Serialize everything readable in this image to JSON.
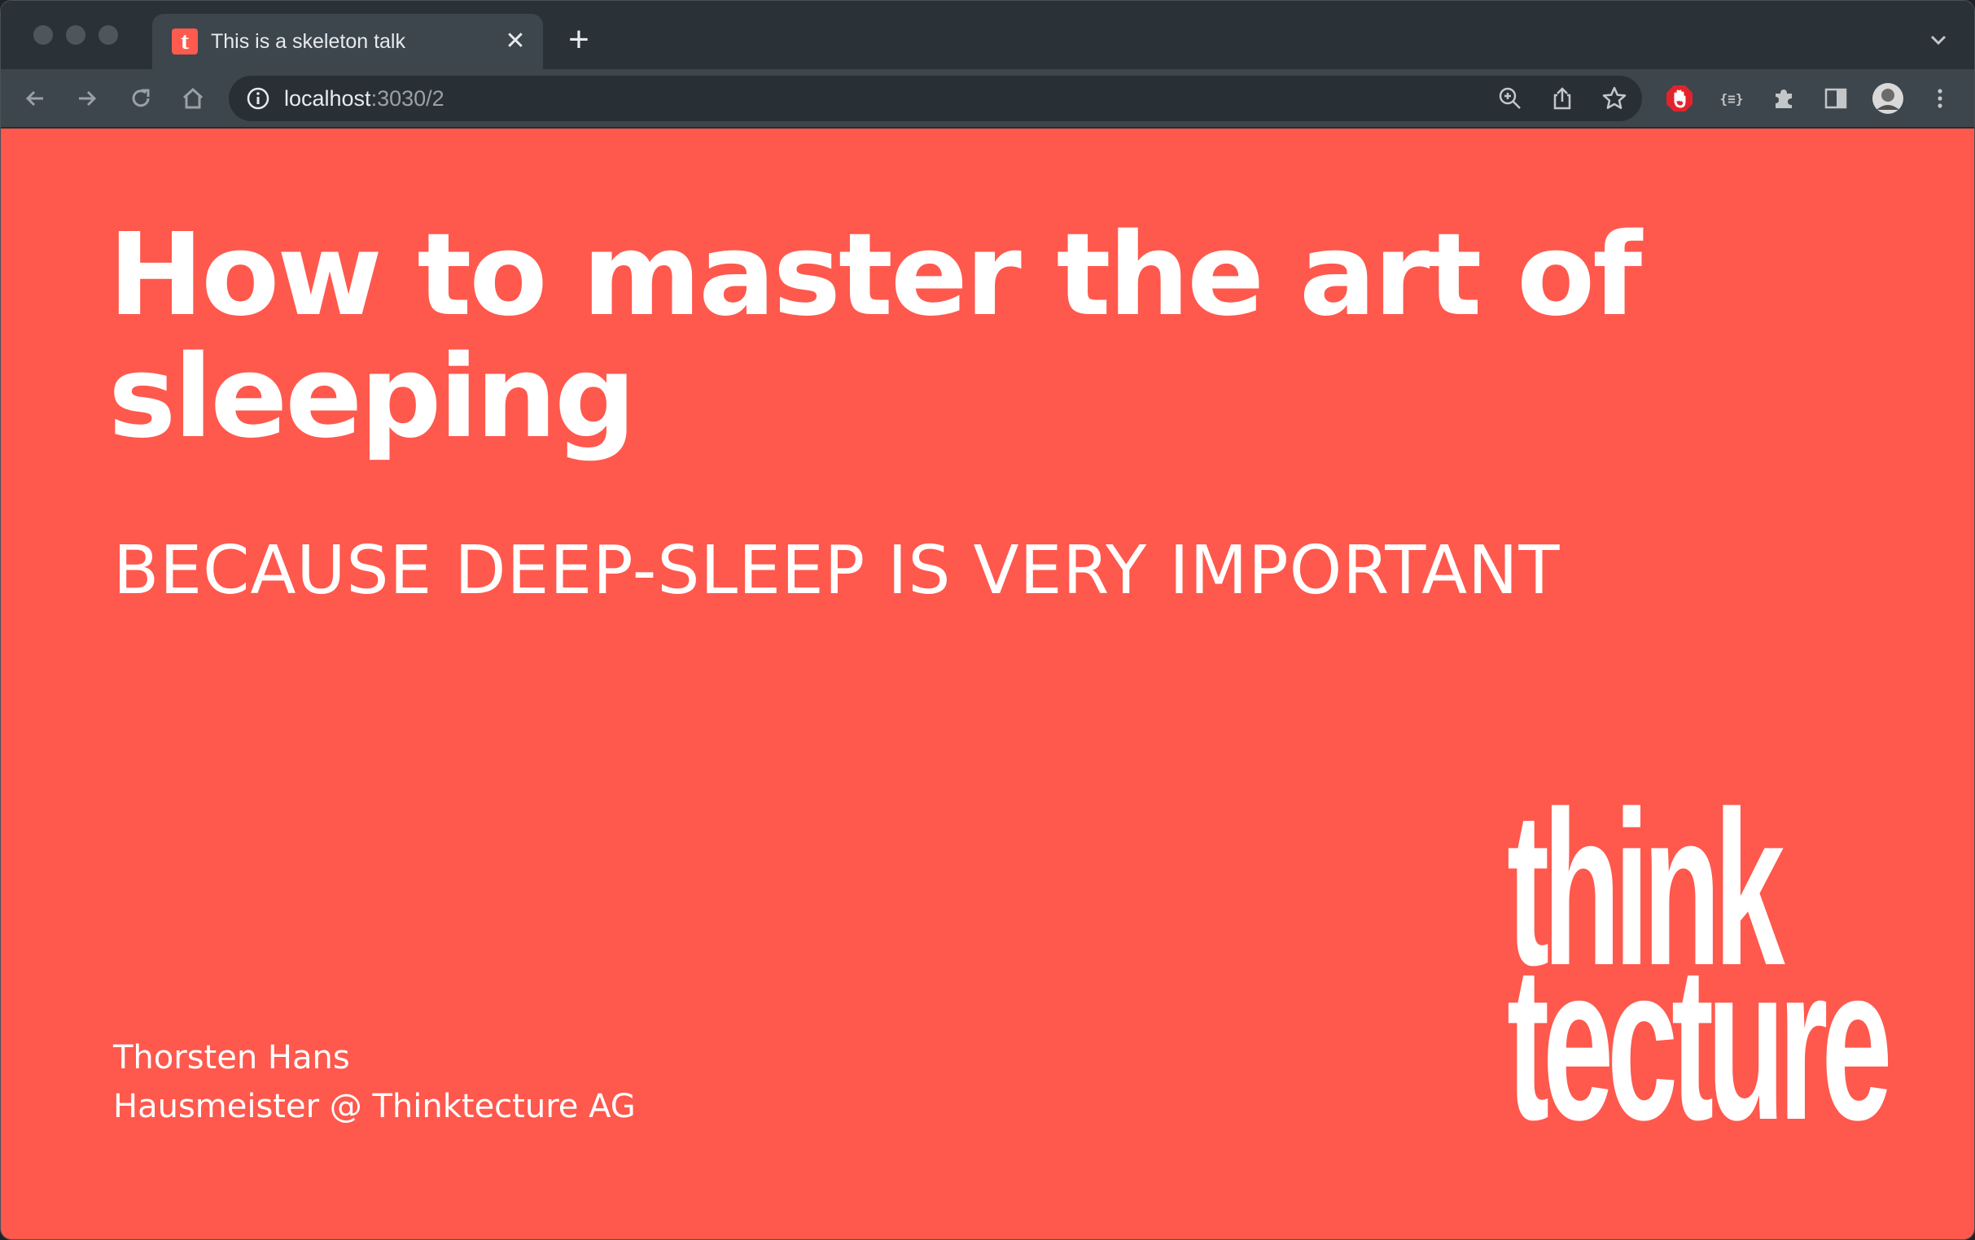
{
  "browser": {
    "tab": {
      "title": "This is a skeleton talk",
      "favicon_letter": "t",
      "close_glyph": "✕"
    },
    "new_tab_glyph": "+",
    "address": {
      "host": "localhost",
      "rest": ":3030/2"
    }
  },
  "slide": {
    "title": "How to master the art of sleeping",
    "subtitle": "BECAUSE DEEP-SLEEP IS VERY IMPORTANT",
    "author_name": "Thorsten Hans",
    "author_role": "Hausmeister @ Thinktecture AG",
    "logo_line1": "think",
    "logo_line2": "tecture",
    "background_color": "#ff584d"
  },
  "colors": {
    "chrome_dark": "#2a3237",
    "chrome_light": "#3c464c",
    "icon": "#c4c7c9"
  }
}
